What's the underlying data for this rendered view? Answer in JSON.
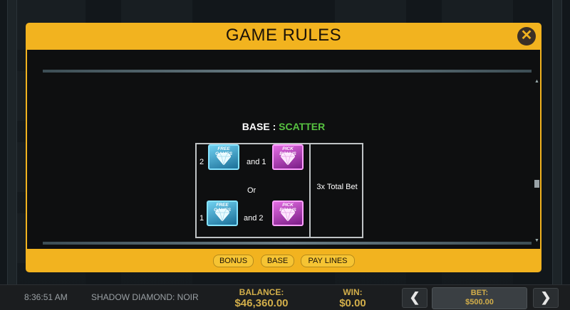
{
  "modal": {
    "title": "GAME RULES",
    "close_icon": "close-icon",
    "section": {
      "prefix": "BASE : ",
      "accent": "SCATTER",
      "accent_color": "#57c341"
    },
    "rules": {
      "row1": {
        "count_free": "2",
        "connector": "and 1"
      },
      "or_text": "Or",
      "row2": {
        "count_free": "1",
        "connector": "and 2"
      },
      "payout": "3x Total Bet",
      "free_games_label": "FREE GAMES",
      "pick_bonus_label": "PICK BONUS"
    },
    "footer_tabs": [
      "BONUS",
      "BASE",
      "PAY LINES"
    ]
  },
  "status_bar": {
    "time": "8:36:51 AM",
    "game_name": "SHADOW DIAMOND: NOIR",
    "balance_label": "BALANCE:",
    "balance_value": "$46,360.00",
    "win_label": "WIN:",
    "win_value": "$0.00",
    "bet_label": "BET:",
    "bet_value": "$500.00",
    "prev_icon": "chevron-left-icon",
    "next_icon": "chevron-right-icon"
  },
  "colors": {
    "accent": "#f2b31f",
    "body_bg": "#0e0f10",
    "scatter_green": "#57c341"
  }
}
